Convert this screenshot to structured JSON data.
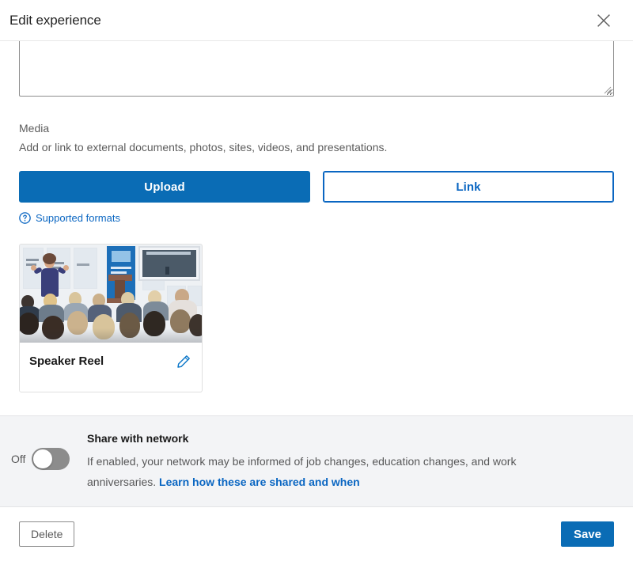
{
  "header": {
    "title": "Edit experience",
    "close_icon": "close-icon"
  },
  "description": {
    "value": "",
    "placeholder": ""
  },
  "media": {
    "label": "Media",
    "subtitle": "Add or link to external documents, photos, sites, videos, and presentations.",
    "upload_label": "Upload",
    "link_label": "Link",
    "supported_formats_label": "Supported formats",
    "supported_formats_icon": "question-circle-icon",
    "items": [
      {
        "title": "Speaker Reel",
        "edit_icon": "pencil-icon",
        "thumbnail_alt": "Speaker presenting to a seated conference audience",
        "screen_caption": "Social Media Overload"
      }
    ]
  },
  "share": {
    "toggle_state_label": "Off",
    "toggle_on": false,
    "title": "Share with network",
    "description": "If enabled, your network may be informed of job changes, education changes, and work anniversaries. ",
    "link_label": "Learn how these are shared and when"
  },
  "footer": {
    "delete_label": "Delete",
    "save_label": "Save"
  },
  "colors": {
    "accent": "#0a66c2",
    "button_blue": "#0a6cb5",
    "panel_bg": "#f3f4f6",
    "toggle_off": "#8c8c8c",
    "text_primary": "#000000e6",
    "text_secondary": "#000000a6"
  }
}
